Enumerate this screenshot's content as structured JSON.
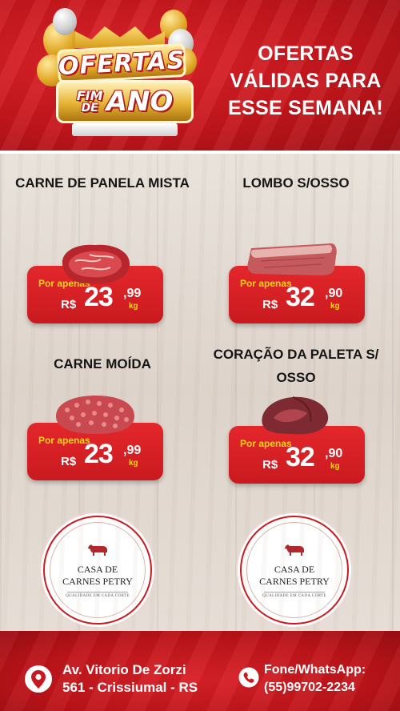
{
  "header": {
    "logo": {
      "ofertas": "OFERTAS",
      "fim": "FIM",
      "de": "DE",
      "ano": "ANO"
    },
    "message_lines": [
      "OFERTAS",
      "VÁLIDAS PARA",
      "ESSE  SEMANA!"
    ]
  },
  "products": [
    {
      "name": "CARNE DE PANELA MISTA",
      "price_prefix": "Por apenas",
      "currency": "R$",
      "price_integer": "23",
      "price_cents": ",99",
      "unit": "kg"
    },
    {
      "name": "LOMBO S/OSSO",
      "price_prefix": "Por apenas",
      "currency": "R$",
      "price_integer": "32",
      "price_cents": ",90",
      "unit": "kg"
    },
    {
      "name": "CARNE MOÍDA",
      "price_prefix": "Por apenas",
      "currency": "R$",
      "price_integer": "23",
      "price_cents": ",99",
      "unit": "kg"
    },
    {
      "name": "CORAÇÃO DA PALETA S/ OSSO",
      "price_prefix": "Por apenas",
      "currency": "R$",
      "price_integer": "32",
      "price_cents": ",90",
      "unit": "kg"
    }
  ],
  "store": {
    "name_line1": "CASA DE",
    "name_line2": "CARNES PETRY",
    "tagline": "QUALIDADE EM CADA CORTE"
  },
  "footer": {
    "address_line1": "Av. Vitorio De Zorzi",
    "address_line2": "561 - Crissiumal - RS",
    "contact_label": "Fone/WhatsApp:",
    "phone": "(55)99702-2234"
  },
  "colors": {
    "brand_red": "#c8191f",
    "price_yellow": "#ffd21a",
    "gold": "#e2a927"
  }
}
